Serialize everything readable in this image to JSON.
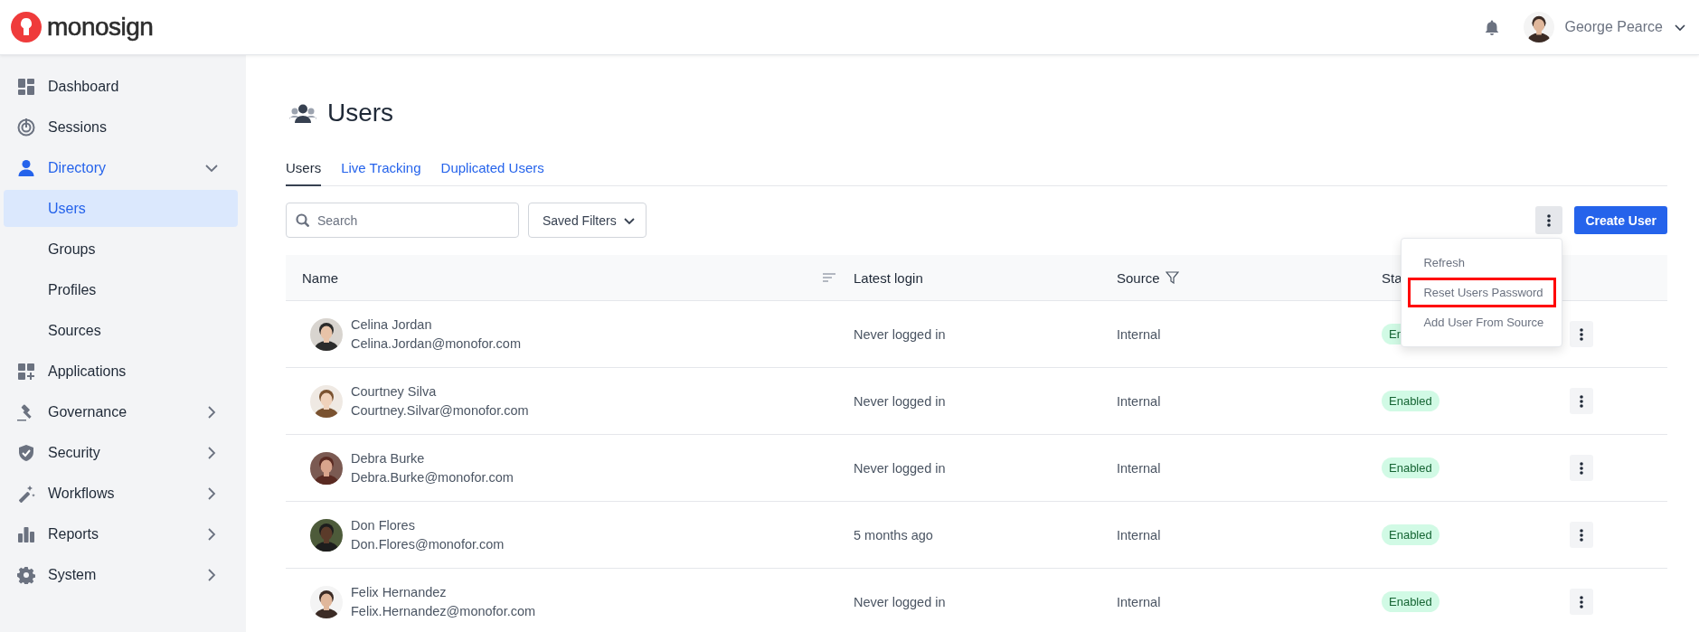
{
  "header": {
    "logo_text": "monosign",
    "user": {
      "name": "George Pearce"
    }
  },
  "sidebar": {
    "items": [
      {
        "label": "Dashboard",
        "selected": false
      },
      {
        "label": "Sessions",
        "selected": false
      },
      {
        "label": "Directory",
        "selected": true,
        "expanded": true,
        "children": [
          {
            "label": "Users",
            "selected": true
          },
          {
            "label": "Groups",
            "selected": false
          },
          {
            "label": "Profiles",
            "selected": false
          },
          {
            "label": "Sources",
            "selected": false
          }
        ]
      },
      {
        "label": "Applications",
        "selected": false
      },
      {
        "label": "Governance",
        "selected": false,
        "expanded": false
      },
      {
        "label": "Security",
        "selected": false,
        "expanded": false
      },
      {
        "label": "Workflows",
        "selected": false,
        "expanded": false
      },
      {
        "label": "Reports",
        "selected": false,
        "expanded": false
      },
      {
        "label": "System",
        "selected": false,
        "expanded": false
      }
    ]
  },
  "page": {
    "title": "Users",
    "tabs": [
      {
        "label": "Users",
        "selected": true
      },
      {
        "label": "Live Tracking",
        "selected": false
      },
      {
        "label": "Duplicated Users",
        "selected": false
      }
    ],
    "search": {
      "placeholder": "Search"
    },
    "saved_filters": "Saved Filters",
    "create_button": "Create User",
    "menu": {
      "items": [
        {
          "label": "Refresh",
          "highlighted": false
        },
        {
          "label": "Reset Users Password",
          "highlighted": true
        },
        {
          "label": "Add User From Source",
          "highlighted": false
        }
      ]
    },
    "table": {
      "columns": [
        "Name",
        "Latest login",
        "Source",
        "Sta"
      ],
      "rows": [
        {
          "name": "Celina Jordan",
          "email": "Celina.Jordan@monofor.com",
          "latest_login": "Never logged in",
          "source": "Internal",
          "status": "En"
        },
        {
          "name": "Courtney Silva",
          "email": "Courtney.Silvar@monofor.com",
          "latest_login": "Never logged in",
          "source": "Internal",
          "status": "Enabled"
        },
        {
          "name": "Debra Burke",
          "email": "Debra.Burke@monofor.com",
          "latest_login": "Never logged in",
          "source": "Internal",
          "status": "Enabled"
        },
        {
          "name": "Don Flores",
          "email": "Don.Flores@monofor.com",
          "latest_login": "5 months ago",
          "source": "Internal",
          "status": "Enabled"
        },
        {
          "name": "Felix Hernandez",
          "email": "Felix.Hernandez@monofor.com",
          "latest_login": "Never logged in",
          "source": "Internal",
          "status": "Enabled"
        }
      ]
    }
  }
}
